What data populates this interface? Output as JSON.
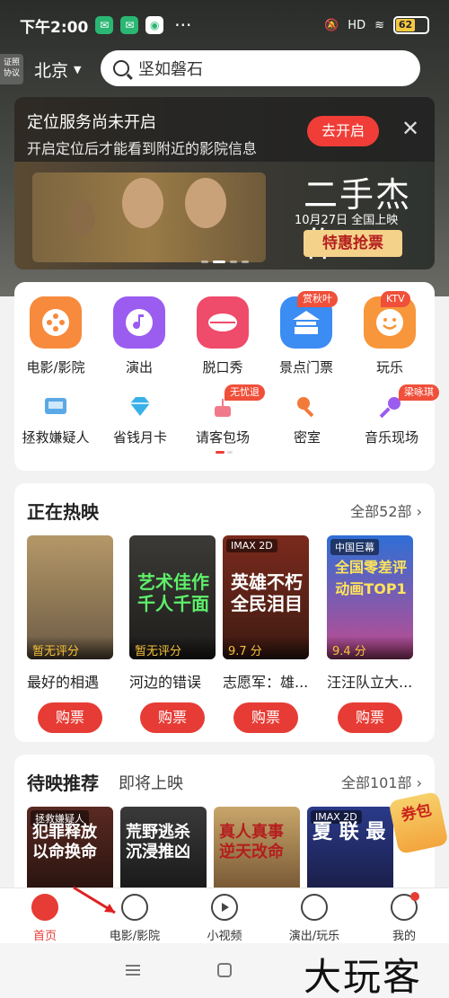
{
  "status_bar": {
    "time": "下午2:00",
    "dots": "···",
    "network": "HD",
    "battery": "62"
  },
  "header": {
    "license_line1": "证照",
    "license_line2": "协议",
    "city": "北京",
    "search_value": "坚如磐石"
  },
  "location_notice": {
    "title": "定位服务尚未开启",
    "subtitle": "开启定位后才能看到附近的影院信息",
    "button": "去开启"
  },
  "banner": {
    "title": "二手杰作",
    "date": "10月27日 全国上映",
    "cta": "特惠抢票"
  },
  "quick_entries": [
    {
      "label": "电影/影院",
      "icon": "film-reel-icon",
      "color": "#f78a3c"
    },
    {
      "label": "演出",
      "icon": "music-note-icon",
      "color": "#9b5cf0"
    },
    {
      "label": "脱口秀",
      "icon": "lips-icon",
      "color": "#ef4b6b"
    },
    {
      "label": "景点门票",
      "icon": "temple-icon",
      "color": "#3b8cf3",
      "badge": "赏秋叶"
    },
    {
      "label": "玩乐",
      "icon": "smiley-icon",
      "color": "#f7963a",
      "badge": "KTV"
    }
  ],
  "secondary_entries": [
    {
      "label": "拯救嫌疑人",
      "icon": "tv-icon"
    },
    {
      "label": "省钱月卡",
      "icon": "diamond-icon"
    },
    {
      "label": "请客包场",
      "icon": "cake-icon",
      "badge": "无忧退"
    },
    {
      "label": "密室",
      "icon": "key-icon"
    },
    {
      "label": "音乐现场",
      "icon": "microphone-icon",
      "badge": "梁咏琪"
    }
  ],
  "now_showing": {
    "title": "正在热映",
    "more": "全部52部",
    "buy_label": "购票",
    "movies": [
      {
        "name": "最好的相遇",
        "score": "暂无评分",
        "big": "",
        "tag": ""
      },
      {
        "name": "河边的错误",
        "score": "暂无评分",
        "big": "艺术佳作 千人千面",
        "tag": ""
      },
      {
        "name": "志愿军：雄...",
        "score": "9.7 分",
        "big": "英雄不朽 全民泪目",
        "tag": "IMAX 2D"
      },
      {
        "name": "汪汪队立大...",
        "score": "9.4 分",
        "big": "全国零差评 动画TOP1",
        "tag": "中国巨幕"
      }
    ]
  },
  "upcoming": {
    "title": "待映推荐",
    "tab2": "即将上映",
    "more": "全部101部",
    "posters": [
      {
        "text": "犯罪释放 以命换命",
        "tag": "拯救嫌疑人"
      },
      {
        "text": "荒野逃杀 沉浸推凶",
        "tag": ""
      },
      {
        "text": "真人真事 逆天改命",
        "tag": ""
      },
      {
        "text": "夏 联 最",
        "tag": "IMAX 2D"
      }
    ],
    "redpacket": "券包"
  },
  "tabbar": [
    {
      "label": "首页",
      "icon": "home-cat-icon",
      "active": true
    },
    {
      "label": "电影/影院",
      "icon": "film-reel-icon"
    },
    {
      "label": "小视频",
      "icon": "play-icon"
    },
    {
      "label": "演出/玩乐",
      "icon": "music-note-icon"
    },
    {
      "label": "我的",
      "icon": "profile-icon",
      "dot": true
    }
  ],
  "watermark": "大玩客"
}
